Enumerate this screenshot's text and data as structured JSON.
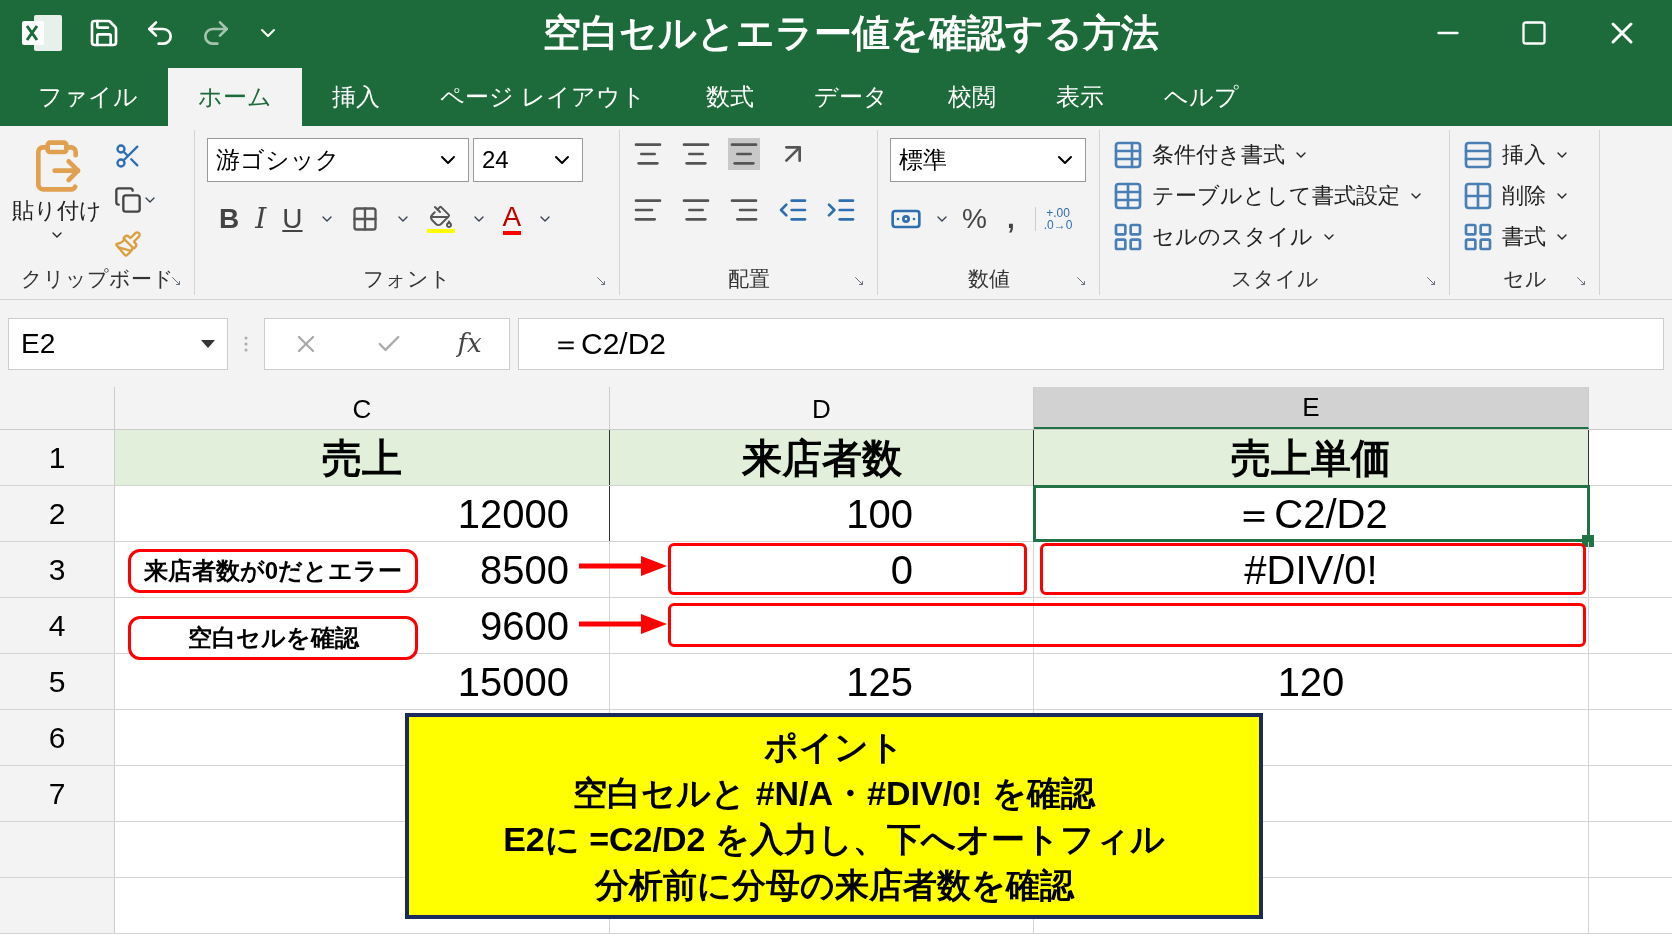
{
  "window": {
    "title": "空白セルとエラー値を確認する方法"
  },
  "tabs": [
    {
      "label": "ファイル",
      "selected": false
    },
    {
      "label": "ホーム",
      "selected": true
    },
    {
      "label": "挿入",
      "selected": false
    },
    {
      "label": "ページ レイアウト",
      "selected": false
    },
    {
      "label": "数式",
      "selected": false
    },
    {
      "label": "データ",
      "selected": false
    },
    {
      "label": "校閲",
      "selected": false
    },
    {
      "label": "表示",
      "selected": false
    },
    {
      "label": "ヘルプ",
      "selected": false
    }
  ],
  "ribbon": {
    "clipboard": {
      "paste": "貼り付け",
      "label": "クリップボード"
    },
    "font": {
      "name": "游ゴシック",
      "size": "24",
      "bold": "B",
      "italic": "I",
      "underline": "U",
      "font_color": "A",
      "label": "フォント"
    },
    "alignment": {
      "label": "配置"
    },
    "number": {
      "format": "標準",
      "percent": "%",
      "comma": ",",
      "increase_decimal": "+.00",
      "decrease_decimal": ".0→0",
      "label": "数値"
    },
    "styles": {
      "items": [
        "条件付き書式",
        "テーブルとして書式設定",
        "セルのスタイル"
      ],
      "label": "スタイル"
    },
    "cells": {
      "items": [
        "挿入",
        "削除",
        "書式"
      ],
      "label": "セル"
    }
  },
  "formula_bar": {
    "name_box": "E2",
    "fx": "fx",
    "formula": "＝C2/D2"
  },
  "sheet": {
    "columns": [
      {
        "label": "C",
        "selected": false
      },
      {
        "label": "D",
        "selected": false
      },
      {
        "label": "E",
        "selected": true
      }
    ],
    "rows": [
      {
        "header": "1",
        "kind": "heading",
        "cells": [
          {
            "text": "売上",
            "selected": false
          },
          {
            "text": "来店者数",
            "selected": false
          },
          {
            "text": "売上単価",
            "selected": false
          }
        ]
      },
      {
        "header": "2",
        "kind": "data",
        "cells": [
          {
            "text": "12000",
            "selected": false
          },
          {
            "text": "100",
            "selected": false
          },
          {
            "text": "＝C2/D2",
            "selected": true
          }
        ]
      },
      {
        "header": "3",
        "kind": "data",
        "cells": [
          {
            "text": "8500",
            "selected": false
          },
          {
            "text": "0",
            "selected": false
          },
          {
            "text": "#DIV/0!",
            "selected": false
          }
        ]
      },
      {
        "header": "4",
        "kind": "data",
        "cells": [
          {
            "text": "9600",
            "selected": false
          },
          {
            "selected": false
          },
          {
            "selected": false
          }
        ]
      },
      {
        "header": "5",
        "kind": "data",
        "cells": [
          {
            "text": "15000",
            "selected": false
          },
          {
            "text": "125",
            "selected": false
          },
          {
            "text": "120",
            "selected": false
          }
        ]
      },
      {
        "header": "6",
        "kind": "data",
        "cells": []
      },
      {
        "header": "7",
        "kind": "data",
        "cells": []
      },
      {
        "kind": "data",
        "cells": []
      },
      {
        "kind": "data",
        "cells": []
      }
    ]
  },
  "callouts": [
    {
      "text": "来店者数が0だとエラー"
    },
    {
      "text": "空白セルを確認"
    }
  ],
  "note": {
    "title": "ポイント",
    "lines": [
      "空白セルと #N/A・#DIV/0! を確認",
      "E2に =C2/D2 を入力し、下へオートフィル",
      "分析前に分母の来店者数を確認"
    ]
  }
}
